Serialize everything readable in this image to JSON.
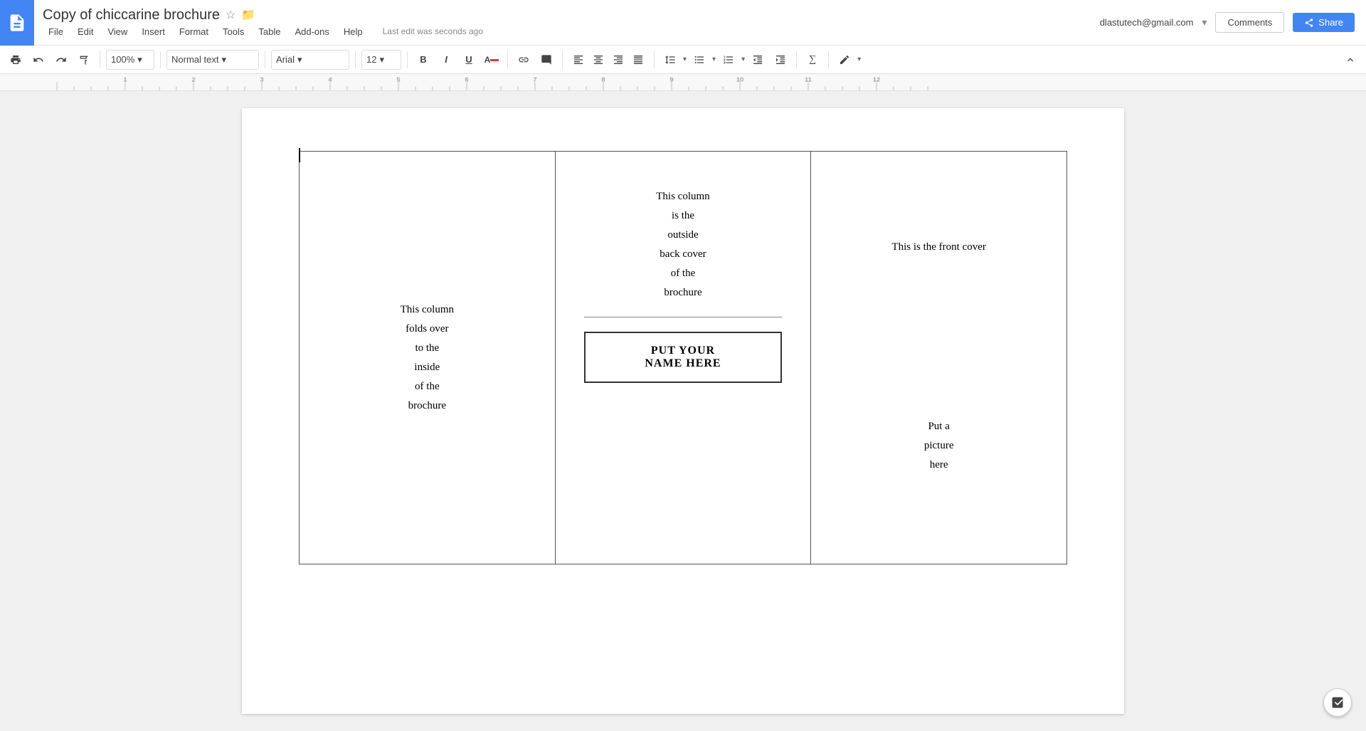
{
  "app": {
    "icon_color": "#4285F4",
    "doc_title": "Copy of chiccarine brochure",
    "user_email": "dlastutech@gmail.com",
    "last_edit": "Last edit was seconds ago",
    "comments_label": "Comments",
    "share_label": "Share"
  },
  "menu": {
    "items": [
      "File",
      "Edit",
      "View",
      "Insert",
      "Format",
      "Tools",
      "Table",
      "Add-ons",
      "Help"
    ]
  },
  "toolbar": {
    "zoom": "100%",
    "style": "Normal text",
    "font": "Arial",
    "size": "12"
  },
  "document": {
    "col1": {
      "line1": "This column",
      "line2": "folds over",
      "line3": "to the",
      "line4": "inside",
      "line5": "of the",
      "line6": "brochure"
    },
    "col2": {
      "line1": "This column",
      "line2": "is the",
      "line3": "outside",
      "line4": "back cover",
      "line5": "of the",
      "line6": "brochure",
      "name_line1": "PUT YOUR",
      "name_line2": "NAME HERE"
    },
    "col3": {
      "front_cover": "This is the front cover",
      "pic_line1": "Put a",
      "pic_line2": "picture",
      "pic_line3": "here"
    }
  }
}
